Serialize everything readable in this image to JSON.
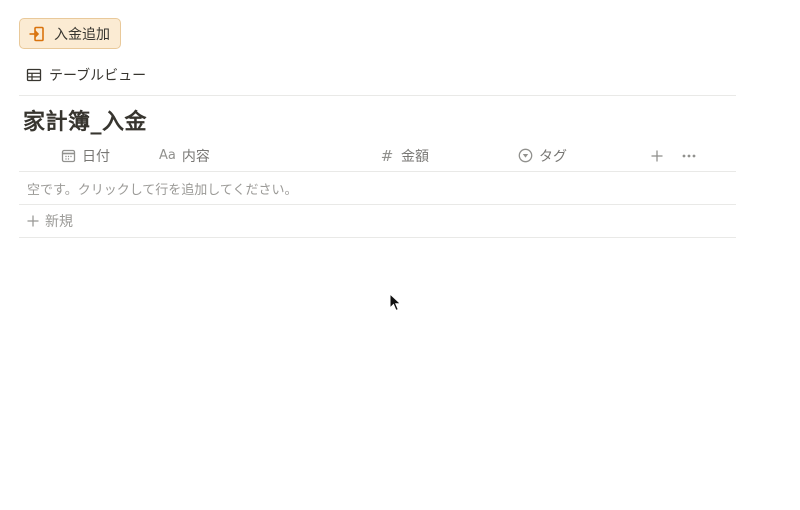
{
  "action_button": {
    "label": "入金追加",
    "icon": "enter-icon",
    "bg_color": "#fbebd3",
    "icon_color": "#d9730d"
  },
  "view_tab": {
    "label": "テーブルビュー",
    "icon": "table-icon"
  },
  "database": {
    "title": "家計簿_入金"
  },
  "columns": [
    {
      "label": "日付",
      "icon": "calendar-icon"
    },
    {
      "label": "内容",
      "icon": "text-aa-icon",
      "icon_text": "Aa"
    },
    {
      "label": "金額",
      "icon": "hash-icon",
      "icon_text": "#"
    },
    {
      "label": "タグ",
      "icon": "select-icon"
    }
  ],
  "header_actions": {
    "add_property": "plus-icon",
    "more": "more-horizontal-icon"
  },
  "empty_message": "空です。クリックして行を追加してください。",
  "new_row": {
    "label": "新規",
    "icon": "plus-icon"
  }
}
